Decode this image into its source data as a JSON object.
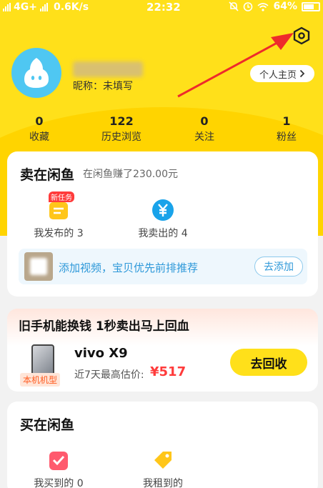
{
  "status_bar": {
    "network": "4G+",
    "speed": "0.6K/s",
    "time": "22:32",
    "battery": "64%"
  },
  "profile": {
    "nickname": "昵称：未填写",
    "profile_button": "个人主页"
  },
  "stats": [
    {
      "value": "0",
      "label": "收藏"
    },
    {
      "value": "122",
      "label": "历史浏览"
    },
    {
      "value": "0",
      "label": "关注"
    },
    {
      "value": "1",
      "label": "粉丝"
    }
  ],
  "sell_card": {
    "title": "卖在闲鱼",
    "subtitle": "在闲鱼赚了230.00元",
    "items": [
      {
        "label": "我发布的 3",
        "badge": "新任务",
        "icon": "publish-icon"
      },
      {
        "label": "我卖出的 4",
        "icon": "yuan-icon"
      }
    ],
    "tip_text": "添加视频，宝贝优先前排推荐",
    "tip_button": "去添加"
  },
  "recycle_card": {
    "title": "旧手机能换钱 1秒卖出马上回血",
    "phone_tag": "本机机型",
    "phone_name": "vivo X9",
    "price_label": "近7天最高估价:",
    "price": "¥517",
    "button": "去回收"
  },
  "buy_card": {
    "title": "买在闲鱼",
    "items": [
      {
        "label": "我买到的 0",
        "icon": "bought-icon"
      },
      {
        "label": "我租到的",
        "icon": "rented-icon"
      }
    ]
  },
  "colors": {
    "brand_yellow": "#ffe01a",
    "accent_blue": "#2d98d9",
    "price_red": "#ff3b3b"
  }
}
